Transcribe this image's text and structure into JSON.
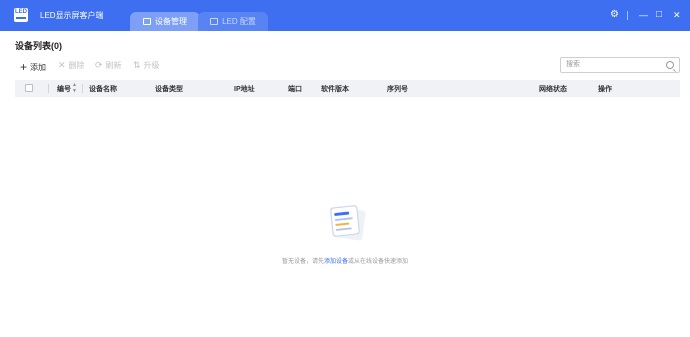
{
  "app": {
    "title": "LED显示屏客户端",
    "logo_text": "LED"
  },
  "tabs": [
    {
      "label": "设备管理",
      "active": true
    },
    {
      "label": "LED 配置",
      "active": false
    }
  ],
  "window_controls": {
    "settings": "⚙",
    "minimize": "—",
    "maximize": "□",
    "close": "✕"
  },
  "page": {
    "title": "设备列表(0)"
  },
  "toolbar": {
    "add": {
      "label": "添加",
      "icon": "+"
    },
    "delete": {
      "label": "删除",
      "icon": "✕"
    },
    "refresh": {
      "label": "刷新",
      "icon": "⟳"
    },
    "upgrade": {
      "label": "升级",
      "icon": "⇅"
    }
  },
  "search": {
    "placeholder": "搜索"
  },
  "table": {
    "columns": [
      "编号",
      "设备名称",
      "设备类型",
      "IP地址",
      "端口",
      "软件版本",
      "序列号",
      "网络状态",
      "操作"
    ],
    "rows": []
  },
  "empty": {
    "prefix": "暂无设备，请先",
    "link": "添加设备",
    "suffix": "或从在线设备快速添加"
  },
  "colors": {
    "accent": "#3d6ff0",
    "header_bg": "#f1f2f6"
  }
}
